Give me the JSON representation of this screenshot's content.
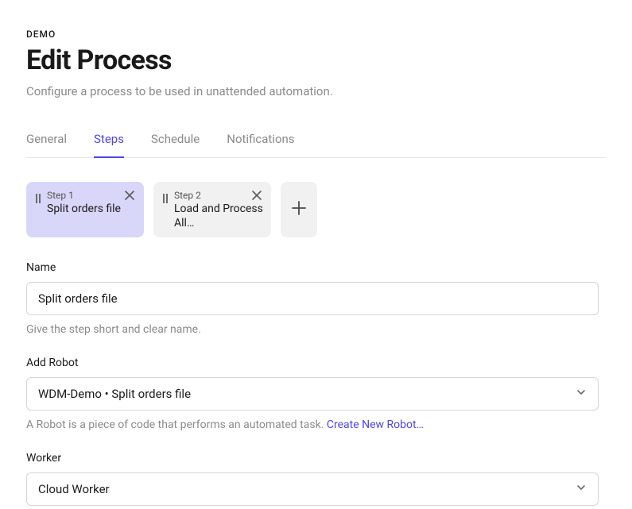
{
  "breadcrumb": "DEMO",
  "title": "Edit Process",
  "subtitle": "Configure a process to be used in unattended automation.",
  "tabs": [
    {
      "label": "General",
      "active": false
    },
    {
      "label": "Steps",
      "active": true
    },
    {
      "label": "Schedule",
      "active": false
    },
    {
      "label": "Notifications",
      "active": false
    }
  ],
  "steps": [
    {
      "label": "Step 1",
      "name": "Split orders file",
      "selected": true
    },
    {
      "label": "Step 2",
      "name": "Load and Process All…",
      "selected": false
    }
  ],
  "nameField": {
    "label": "Name",
    "value": "Split orders file",
    "help": "Give the step short and clear name."
  },
  "robotField": {
    "label": "Add Robot",
    "value": "WDM-Demo • Split orders file",
    "help": "A Robot is a piece of code that performs an automated task. ",
    "link": "Create New Robot…"
  },
  "workerField": {
    "label": "Worker",
    "value": "Cloud Worker"
  }
}
